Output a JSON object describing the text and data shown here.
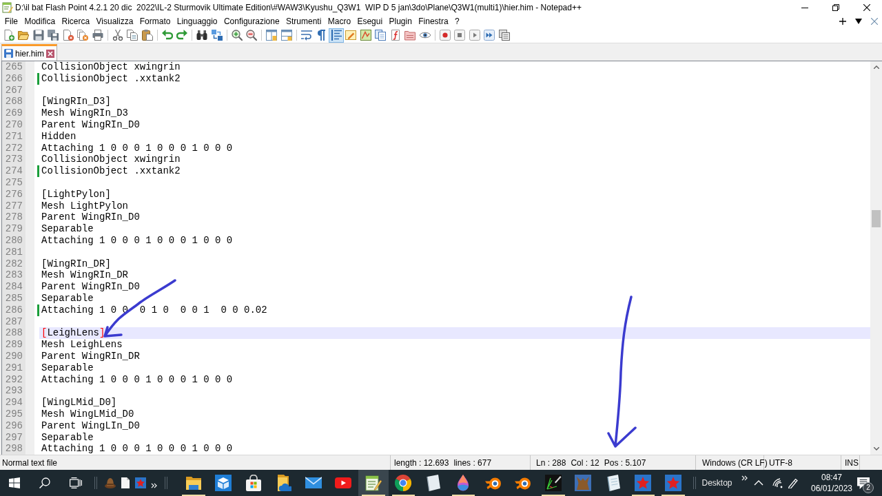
{
  "window": {
    "title": "D:\\il bat Flash Point 4.2.1 20 dic  2022\\IL-2 Sturmovik Ultimate Edition\\#WAW3\\Kyushu_Q3W1  WIP D 5 jan\\3do\\Plane\\Q3W1(multi1)\\hier.him - Notepad++"
  },
  "menu": [
    "File",
    "Modifica",
    "Ricerca",
    "Visualizza",
    "Formato",
    "Linguaggio",
    "Configurazione",
    "Strumenti",
    "Macro",
    "Esegui",
    "Plugin",
    "Finestra",
    "?"
  ],
  "toolbar": [
    [
      {
        "kind": "new",
        "on": false
      },
      {
        "kind": "open",
        "on": false
      },
      {
        "kind": "save",
        "on": false
      },
      {
        "kind": "saveall",
        "on": false
      },
      {
        "kind": "close",
        "on": false
      },
      {
        "kind": "closeall",
        "on": false
      },
      {
        "kind": "print",
        "on": false
      }
    ],
    [
      {
        "kind": "cut",
        "on": false
      },
      {
        "kind": "copy",
        "on": false
      },
      {
        "kind": "paste",
        "on": false
      }
    ],
    [
      {
        "kind": "undo",
        "on": false
      },
      {
        "kind": "redo",
        "on": false
      }
    ],
    [
      {
        "kind": "find",
        "on": false
      },
      {
        "kind": "replace",
        "on": false
      }
    ],
    [
      {
        "kind": "zoomin",
        "on": false
      },
      {
        "kind": "zoomout",
        "on": false
      }
    ],
    [
      {
        "kind": "syncv",
        "on": false
      },
      {
        "kind": "synch",
        "on": false
      }
    ],
    [
      {
        "kind": "wrap",
        "on": false
      },
      {
        "kind": "allchars",
        "on": false
      },
      {
        "kind": "indent",
        "on": true
      },
      {
        "kind": "language",
        "on": false
      },
      {
        "kind": "docmap",
        "on": false
      },
      {
        "kind": "doclist",
        "on": false
      },
      {
        "kind": "funclist",
        "on": false
      },
      {
        "kind": "workspace",
        "on": false
      },
      {
        "kind": "monitor",
        "on": false
      }
    ],
    [
      {
        "kind": "record",
        "on": false
      },
      {
        "kind": "stop",
        "on": false
      },
      {
        "kind": "play",
        "on": false
      },
      {
        "kind": "playmulti",
        "on": false
      },
      {
        "kind": "savemacro",
        "on": false
      }
    ]
  ],
  "tabs": [
    {
      "label": "hier.him",
      "selected": true,
      "saved": true
    }
  ],
  "editor": {
    "lines": [
      {
        "number": "265",
        "text": "CollisionObject xwingrin",
        "changed": false,
        "current": false,
        "brace_match": false
      },
      {
        "number": "266",
        "text": "CollisionObject .xxtank2",
        "changed": true,
        "current": false,
        "brace_match": false
      },
      {
        "number": "267",
        "changed": false,
        "current": false,
        "brace_match": false
      },
      {
        "number": "268",
        "text": "[WingRIn_D3]",
        "changed": false,
        "current": false,
        "brace_match": false
      },
      {
        "number": "269",
        "text": "Mesh WingRIn_D3",
        "changed": false,
        "current": false,
        "brace_match": false
      },
      {
        "number": "270",
        "text": "Parent WingRIn_D0",
        "changed": false,
        "current": false,
        "brace_match": false
      },
      {
        "number": "271",
        "text": "Hidden",
        "changed": false,
        "current": false,
        "brace_match": false
      },
      {
        "number": "272",
        "text": "Attaching 1 0 0 0 1 0 0 0 1 0 0 0",
        "changed": false,
        "current": false,
        "brace_match": false
      },
      {
        "number": "273",
        "text": "CollisionObject xwingrin",
        "changed": false,
        "current": false,
        "brace_match": false
      },
      {
        "number": "274",
        "text": "CollisionObject .xxtank2",
        "changed": true,
        "current": false,
        "brace_match": false
      },
      {
        "number": "275",
        "changed": false,
        "current": false,
        "brace_match": false
      },
      {
        "number": "276",
        "text": "[LightPylon]",
        "changed": false,
        "current": false,
        "brace_match": false
      },
      {
        "number": "277",
        "text": "Mesh LightPylon",
        "changed": false,
        "current": false,
        "brace_match": false
      },
      {
        "number": "278",
        "text": "Parent WingRIn_D0",
        "changed": false,
        "current": false,
        "brace_match": false
      },
      {
        "number": "279",
        "text": "Separable",
        "changed": false,
        "current": false,
        "brace_match": false
      },
      {
        "number": "280",
        "text": "Attaching 1 0 0 0 1 0 0 0 1 0 0 0",
        "changed": false,
        "current": false,
        "brace_match": false
      },
      {
        "number": "281",
        "changed": false,
        "current": false,
        "brace_match": false
      },
      {
        "number": "282",
        "text": "[WingRIn_DR]",
        "changed": false,
        "current": false,
        "brace_match": false
      },
      {
        "number": "283",
        "text": "Mesh WingRIn_DR",
        "changed": false,
        "current": false,
        "brace_match": false
      },
      {
        "number": "284",
        "text": "Parent WingRIn_D0",
        "changed": false,
        "current": false,
        "brace_match": false
      },
      {
        "number": "285",
        "text": "Separable",
        "changed": false,
        "current": false,
        "brace_match": false
      },
      {
        "number": "286",
        "text": "Attaching 1 0 0  0 1 0  0 0 1  0 0 0.02",
        "changed": true,
        "current": false,
        "brace_match": false
      },
      {
        "number": "287",
        "changed": false,
        "current": false,
        "brace_match": false
      },
      {
        "number": "288",
        "text": "[LeighLens]",
        "changed": false,
        "current": true,
        "brace_match": true
      },
      {
        "number": "289",
        "text": "Mesh LeighLens",
        "changed": false,
        "current": false,
        "brace_match": false
      },
      {
        "number": "290",
        "text": "Parent WingRIn_DR",
        "changed": false,
        "current": false,
        "brace_match": false
      },
      {
        "number": "291",
        "text": "Separable",
        "changed": false,
        "current": false,
        "brace_match": false
      },
      {
        "number": "292",
        "text": "Attaching 1 0 0 0 1 0 0 0 1 0 0 0",
        "changed": false,
        "current": false,
        "brace_match": false
      },
      {
        "number": "293",
        "changed": false,
        "current": false,
        "brace_match": false
      },
      {
        "number": "294",
        "text": "[WingLMid_D0]",
        "changed": false,
        "current": false,
        "brace_match": false
      },
      {
        "number": "295",
        "text": "Mesh WingLMid_D0",
        "changed": false,
        "current": false,
        "brace_match": false
      },
      {
        "number": "296",
        "text": "Parent WingLIn_D0",
        "changed": false,
        "current": false,
        "brace_match": false
      },
      {
        "number": "297",
        "text": "Separable",
        "changed": false,
        "current": false,
        "brace_match": false
      },
      {
        "number": "298",
        "text": "Attaching 1 0 0 0 1 0 0 0 1 0 0 0",
        "changed": false,
        "current": false,
        "brace_match": false
      }
    ]
  },
  "annotations": [
    {
      "kind": "arrow"
    },
    {
      "kind": "arrow"
    }
  ],
  "status_bar": {
    "file_type": "Normal text file",
    "length": "length : 12.693",
    "lines": "lines : 677",
    "line": "Ln : 288",
    "column": "Col : 12",
    "position": "Pos : 5.107",
    "eol": "Windows (CR LF)",
    "encoding": "UTF-8",
    "mode": "INS"
  },
  "taskbar": {
    "quick_launch": [
      {
        "kind": "hat"
      },
      {
        "kind": "page"
      },
      {
        "kind": "star"
      }
    ],
    "apps": [
      {
        "kind": "folder",
        "running": true,
        "selected": false
      },
      {
        "kind": "box",
        "running": false,
        "selected": false
      },
      {
        "kind": "bag",
        "running": false,
        "selected": false
      },
      {
        "kind": "cloudfolder",
        "running": false,
        "selected": false
      },
      {
        "kind": "envelope",
        "running": false,
        "selected": false
      },
      {
        "kind": "video",
        "running": false,
        "selected": false
      },
      {
        "kind": "notepad",
        "running": true,
        "selected": true
      },
      {
        "kind": "browser",
        "running": true,
        "selected": false
      },
      {
        "kind": "notebook",
        "running": false,
        "selected": false
      },
      {
        "kind": "drop",
        "running": true,
        "selected": false
      },
      {
        "kind": "ring",
        "running": false,
        "selected": false
      },
      {
        "kind": "ring",
        "running": false,
        "selected": false
      },
      {
        "kind": "pentool",
        "running": true,
        "selected": false
      },
      {
        "kind": "creature",
        "running": false,
        "selected": false
      },
      {
        "kind": "pad",
        "running": false,
        "selected": false
      },
      {
        "kind": "star",
        "running": true,
        "selected": false
      },
      {
        "kind": "star",
        "running": true,
        "selected": false
      }
    ],
    "toolbar_label": "Desktop",
    "time": "08:47",
    "date": "06/01/2023",
    "notification_count": "2"
  }
}
